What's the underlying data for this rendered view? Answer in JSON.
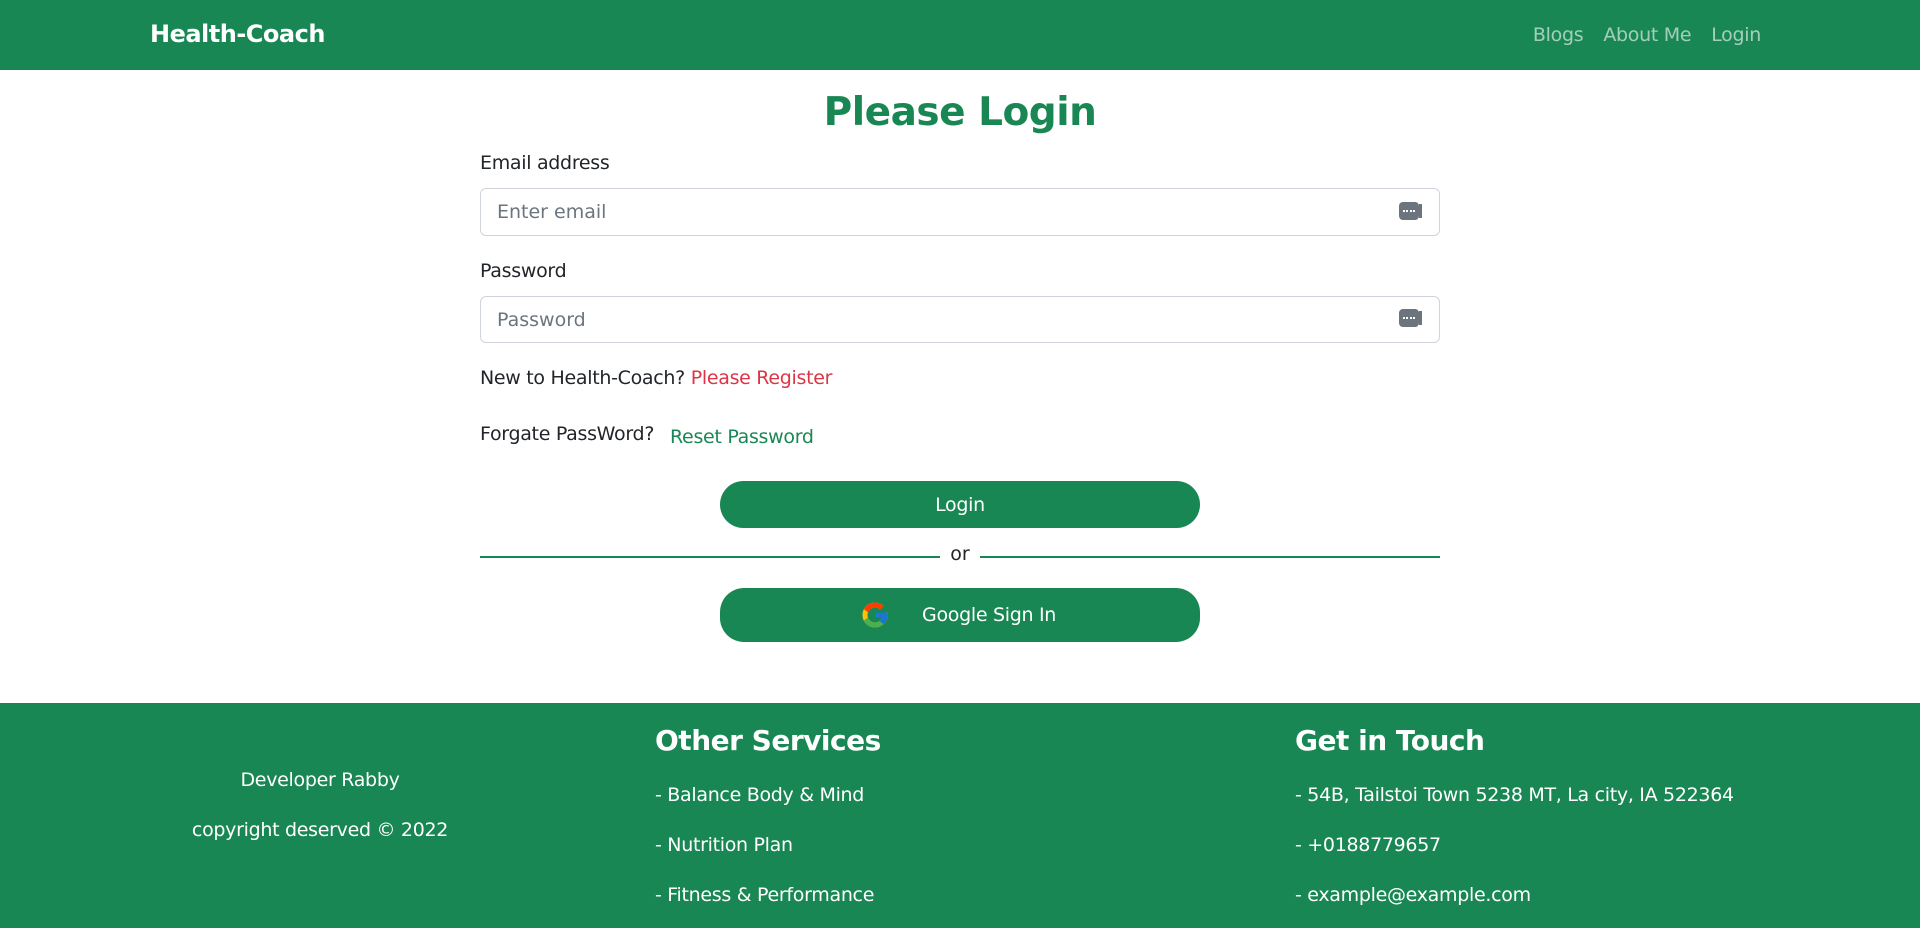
{
  "navbar": {
    "brand": "Health-Coach",
    "links": [
      "Blogs",
      "About Me",
      "Login"
    ]
  },
  "login_form": {
    "title": "Please Login",
    "email_label": "Email address",
    "email_placeholder": "Enter email",
    "email_value": "",
    "password_label": "Password",
    "password_placeholder": "Password",
    "password_value": "",
    "new_user_text": "New to Health-Coach?",
    "register_link": "Please Register",
    "forgot_text": "Forgate PassWord?",
    "reset_link": "Reset Password",
    "login_button": "Login",
    "divider_text": "or",
    "google_button": "Google Sign In"
  },
  "footer": {
    "developer": "Developer Rabby",
    "copyright": "copyright deserved © 2022",
    "services_heading": "Other Services",
    "services": [
      "- Balance Body & Mind",
      "- Nutrition Plan",
      "- Fitness & Performance"
    ],
    "contact_heading": "Get in Touch",
    "contact": [
      "- 54B, Tailstoi Town 5238 MT, La city, IA 522364",
      "- +0188779657",
      "- example@example.com"
    ]
  },
  "colors": {
    "primary": "#198754",
    "register_link": "#dc3545"
  }
}
